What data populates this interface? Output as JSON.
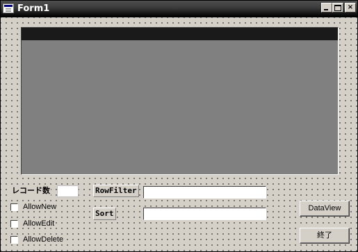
{
  "window": {
    "title": "Form1",
    "minimize_glyph": "",
    "maximize_glyph": "",
    "close_glyph": "×"
  },
  "labels": {
    "record_count": "レコード数",
    "rowfilter": "RowFilter",
    "sort": "Sort"
  },
  "inputs": {
    "record_count_value": "",
    "rowfilter_value": "",
    "sort_value": ""
  },
  "checkboxes": {
    "allow_new": "AllowNew",
    "allow_edit": "AllowEdit",
    "allow_delete": "AllowDelete"
  },
  "buttons": {
    "dataview": "DataView",
    "exit": "終了"
  },
  "icons": [
    "app-icon",
    "minimize-icon",
    "maximize-icon",
    "close-icon"
  ]
}
